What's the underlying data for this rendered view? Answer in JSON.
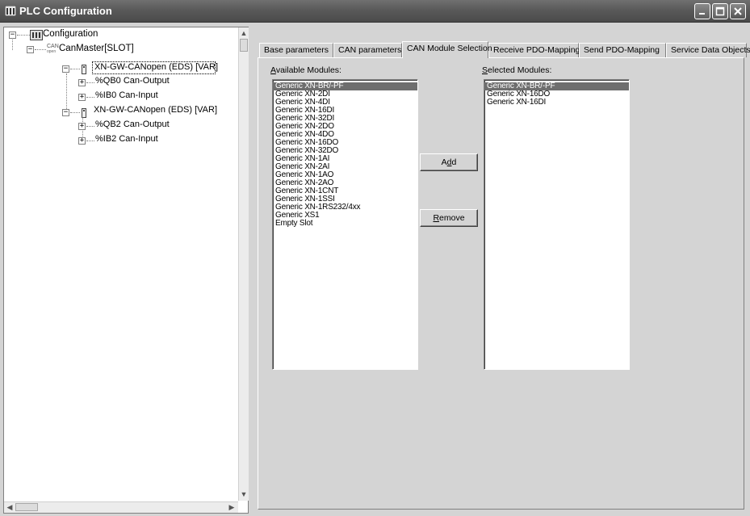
{
  "window": {
    "title": "PLC Configuration"
  },
  "tree": {
    "root": "Configuration",
    "master": "CanMaster[SLOT]",
    "master_icon_text": "CAN",
    "nodes": [
      {
        "label": "XN-GW-CANopen (EDS)  [VAR]",
        "children": [
          "%QB0 Can-Output",
          "%IB0 Can-Input"
        ]
      },
      {
        "label": "XN-GW-CANopen (EDS)  [VAR]",
        "children": [
          "%QB2 Can-Output",
          "%IB2 Can-Input"
        ]
      }
    ]
  },
  "tabs": [
    "Base parameters",
    "CAN parameters",
    "CAN Module Selection",
    "Receive PDO-Mapping",
    "Send PDO-Mapping",
    "Service Data Objects"
  ],
  "active_tab": "CAN Module Selection",
  "available": {
    "label_accel": "A",
    "label_rest": "vailable Modules:",
    "items": [
      "Generic XN-BR/-PF",
      "Generic XN-2DI",
      "Generic XN-4DI",
      "Generic XN-16DI",
      "Generic XN-32DI",
      "Generic XN-2DO",
      "Generic XN-4DO",
      "Generic XN-16DO",
      "Generic XN-32DO",
      "Generic XN-1AI",
      "Generic XN-2AI",
      "Generic XN-1AO",
      "Generic XN-2AO",
      "Generic XN-1CNT",
      "Generic XN-1SSI",
      "Generic XN-1RS232/4xx",
      "Generic XS1",
      "Empty Slot"
    ],
    "selected_index": 0
  },
  "selected": {
    "label_accel": "S",
    "label_rest": "elected Modules:",
    "items": [
      "Generic XN-BR/-PF",
      "Generic XN-16DO",
      "Generic XN-16DI"
    ],
    "selected_index": 0
  },
  "buttons": {
    "add_pre": "A",
    "add_accel": "d",
    "add_post": "d",
    "remove_accel": "R",
    "remove_post": "emove"
  }
}
